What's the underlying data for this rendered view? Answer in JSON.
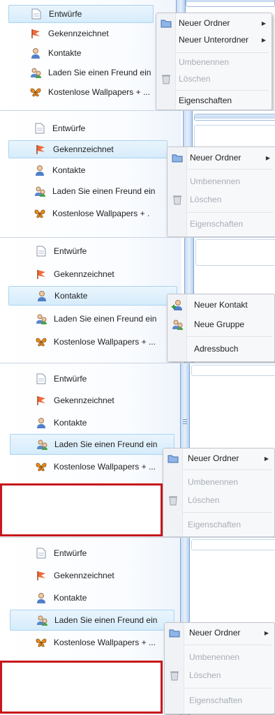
{
  "folders": {
    "drafts": "Entwürfe",
    "flagged": "Gekennzeichnet",
    "contacts": "Kontakte",
    "invite": "Laden Sie einen Freund ein",
    "wallpapers": "Kostenlose Wallpapers + ...",
    "wallpapers_short": "Kostenlose Wallpapers + ."
  },
  "menus": {
    "new_folder": "Neuer Ordner",
    "new_subfolder": "Neuer Unterordner",
    "rename": "Umbenennen",
    "delete": "Löschen",
    "properties": "Eigenschaften",
    "new_contact": "Neuer Kontakt",
    "new_group": "Neue Gruppe",
    "address_book": "Adressbuch"
  },
  "colors": {
    "selection": "#d6ecfb",
    "highlight_box": "#c8171b",
    "disabled_text": "#a7adb6"
  },
  "icons": [
    "drafts-icon",
    "flag-icon",
    "contact-icon",
    "invite-icon",
    "butterfly-icon",
    "folder-icon",
    "trash-icon"
  ]
}
